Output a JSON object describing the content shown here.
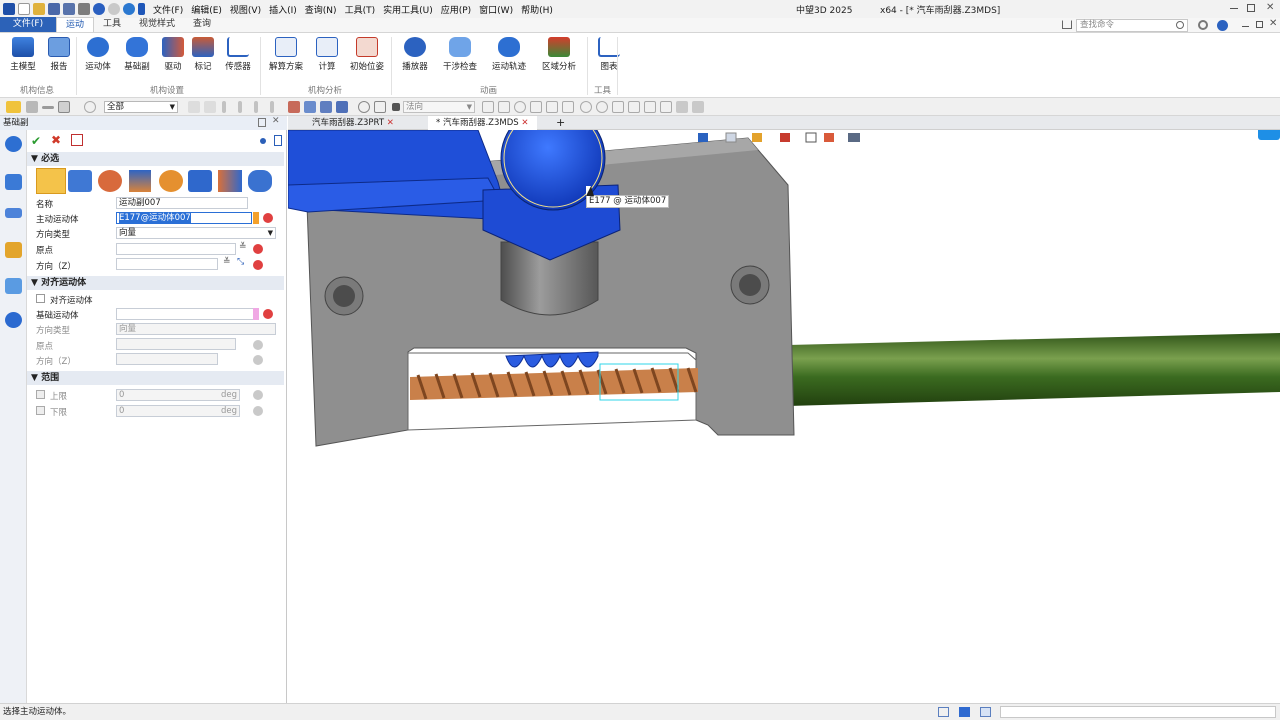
{
  "titlebar": {
    "menus": [
      "文件(F)",
      "编辑(E)",
      "视图(V)",
      "插入(I)",
      "查询(N)",
      "工具(T)",
      "实用工具(U)",
      "应用(P)",
      "窗口(W)",
      "帮助(H)"
    ],
    "app_name": "中望3D 2025",
    "doc_title": "x64 - [* 汽车雨刮器.Z3MDS]",
    "search_placeholder": "查找命令"
  },
  "ribbon": {
    "file_tab": "文件(F)",
    "tabs": [
      "运动",
      "工具",
      "视觉样式",
      "查询"
    ],
    "active_tab": "运动",
    "buttons": [
      {
        "label": "主模型",
        "group": "机构信息"
      },
      {
        "label": "报告",
        "group": "机构信息"
      },
      {
        "label": "运动体",
        "group": "机构设置"
      },
      {
        "label": "基础副",
        "group": "机构设置"
      },
      {
        "label": "驱动",
        "group": "机构设置"
      },
      {
        "label": "标记",
        "group": "机构设置"
      },
      {
        "label": "传感器",
        "group": "机构设置"
      },
      {
        "label": "解算方案",
        "group": "机构分析"
      },
      {
        "label": "计算",
        "group": "机构分析"
      },
      {
        "label": "初始位姿",
        "group": "机构分析"
      },
      {
        "label": "播放器",
        "group": "动画"
      },
      {
        "label": "干涉检查",
        "group": "动画"
      },
      {
        "label": "运动轨迹",
        "group": "动画"
      },
      {
        "label": "区域分析",
        "group": "动画"
      },
      {
        "label": "图表",
        "group": "工具"
      }
    ],
    "groups": [
      "机构信息",
      "机构设置",
      "机构分析",
      "动画",
      "工具"
    ]
  },
  "toolbar2": {
    "filter_value": "全部",
    "direction_value": "法向"
  },
  "panel": {
    "title": "基础副",
    "sections": {
      "required": "必选",
      "align": "对齐运动体",
      "range": "范围"
    },
    "fields": {
      "name_label": "名称",
      "name_value": "运动副007",
      "primary_body_label": "主动运动体",
      "primary_body_value": "E177@运动体007",
      "dir_type_label": "方向类型",
      "dir_type_value": "向量",
      "origin_label": "原点",
      "direction_label": "方向（Z）",
      "align_checkbox_label": "对齐运动体",
      "base_body_label": "基础运动体",
      "dir_type2_label": "方向类型",
      "dir_type2_value": "向量",
      "origin2_label": "原点",
      "direction2_label": "方向（Z）",
      "upper_label": "上限",
      "upper_value": "0",
      "upper_unit": "deg",
      "lower_label": "下限",
      "lower_value": "0",
      "lower_unit": "deg"
    }
  },
  "doc_tabs": [
    {
      "label": "汽车雨刮器.Z3PRT",
      "active": false
    },
    {
      "label": "* 汽车雨刮器.Z3MDS",
      "active": true
    }
  ],
  "viewport": {
    "tooltip": "E177 @ 运动体007"
  },
  "statusbar": {
    "message": "选择主动运动体。"
  },
  "colors": {
    "accent": "#2c62b8",
    "model_blue": "#1f4fd8",
    "housing_gray": "#8f8f8f",
    "screw_copper": "#c9804a",
    "shaft_green": "#3f6b22"
  }
}
